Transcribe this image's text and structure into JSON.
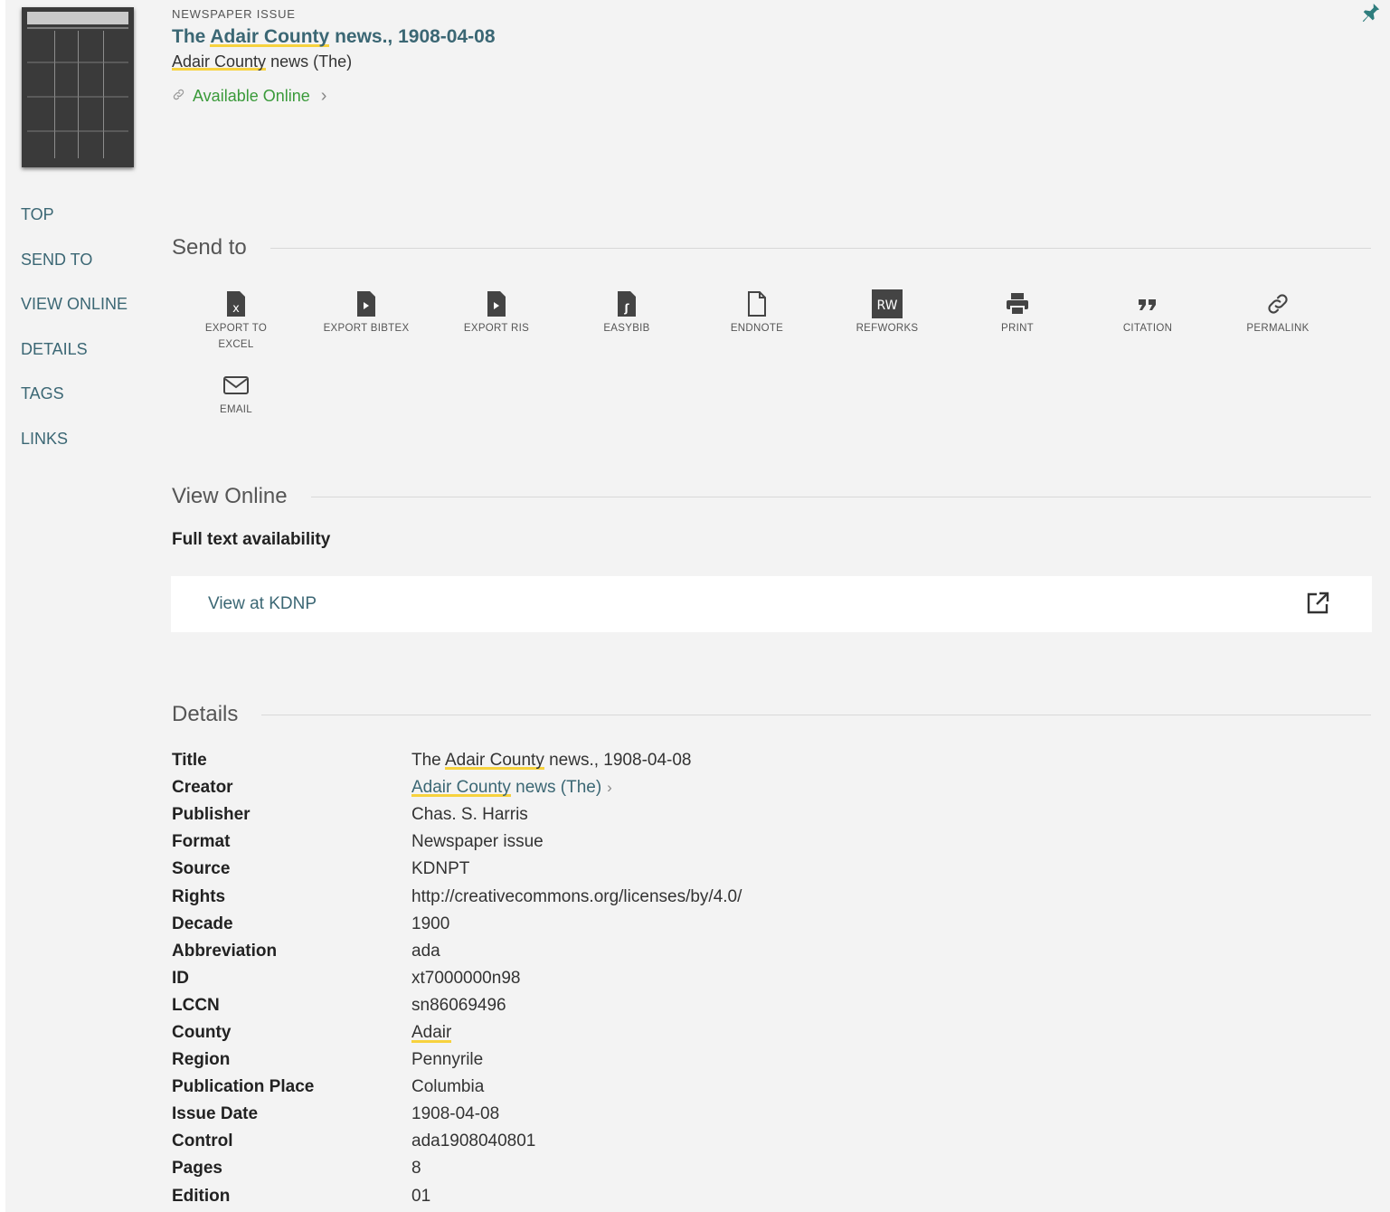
{
  "header": {
    "type_label": "NEWSPAPER ISSUE",
    "title_pre": "The ",
    "title_hl": "Adair County",
    "title_post": " news., 1908-04-08",
    "sub_hl": "Adair County",
    "sub_post": " news (The)",
    "availability": "Available Online",
    "thumbnail_masthead": "The Adair County News"
  },
  "nav": {
    "items": [
      "TOP",
      "SEND TO",
      "VIEW ONLINE",
      "DETAILS",
      "TAGS",
      "LINKS"
    ]
  },
  "send_to": {
    "title": "Send to",
    "actions": [
      {
        "label": "EXPORT TO EXCEL",
        "icon": "excel-file-icon"
      },
      {
        "label": "EXPORT BIBTEX",
        "icon": "bibtex-file-icon"
      },
      {
        "label": "EXPORT RIS",
        "icon": "ris-file-icon"
      },
      {
        "label": "EASYBIB",
        "icon": "easybib-file-icon"
      },
      {
        "label": "ENDNOTE",
        "icon": "endnote-file-icon"
      },
      {
        "label": "REFWORKS",
        "icon": "refworks-icon",
        "icon_text": "RW"
      },
      {
        "label": "PRINT",
        "icon": "printer-icon"
      },
      {
        "label": "CITATION",
        "icon": "quote-icon"
      },
      {
        "label": "PERMALINK",
        "icon": "link-icon"
      },
      {
        "label": "EMAIL",
        "icon": "envelope-icon"
      }
    ]
  },
  "view_online": {
    "title": "View Online",
    "subtitle": "Full text availability",
    "link_text": "View at KDNP"
  },
  "details": {
    "title": "Details",
    "rows": [
      {
        "label": "Title",
        "value": "The Adair County news., 1908-04-08"
      },
      {
        "label": "Creator",
        "value": "Adair County news (The)"
      },
      {
        "label": "Publisher",
        "value": "Chas. S. Harris"
      },
      {
        "label": "Format",
        "value": "Newspaper issue"
      },
      {
        "label": "Source",
        "value": "KDNPT"
      },
      {
        "label": "Rights",
        "value": "http://creativecommons.org/licenses/by/4.0/"
      },
      {
        "label": "Decade",
        "value": "1900"
      },
      {
        "label": "Abbreviation",
        "value": "ada"
      },
      {
        "label": "ID",
        "value": "xt7000000n98"
      },
      {
        "label": "LCCN",
        "value": "sn86069496"
      },
      {
        "label": "County",
        "value": "Adair"
      },
      {
        "label": "Region",
        "value": "Pennyrile"
      },
      {
        "label": "Publication Place",
        "value": "Columbia"
      },
      {
        "label": "Issue Date",
        "value": "1908-04-08"
      },
      {
        "label": "Control",
        "value": "ada1908040801"
      },
      {
        "label": "Pages",
        "value": "8"
      },
      {
        "label": "Edition",
        "value": "01"
      }
    ]
  },
  "colors": {
    "accent_link": "#3b6774",
    "available_green": "#3a9a3a",
    "highlight_yellow": "#f7d23e",
    "pin_teal": "#2e7d7d"
  }
}
